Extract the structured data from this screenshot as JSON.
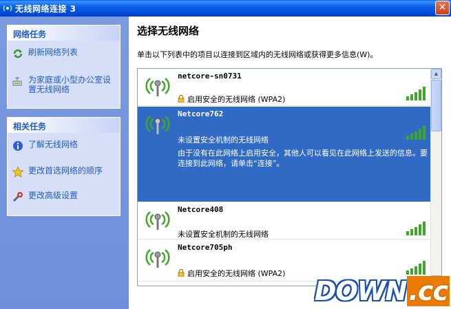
{
  "window": {
    "title": "无线网络连接 3",
    "close_label": "✕"
  },
  "sidebar": {
    "network_tasks": {
      "header": "网络任务",
      "items": [
        {
          "label": "刷新网络列表",
          "icon": "refresh-icon"
        },
        {
          "label": "为家庭或小型办公室设置无线网络",
          "icon": "network-setup-icon"
        }
      ]
    },
    "related_tasks": {
      "header": "相关任务",
      "items": [
        {
          "label": "了解无线网络",
          "icon": "info-icon"
        },
        {
          "label": "更改首选网络的顺序",
          "icon": "star-icon"
        },
        {
          "label": "更改高级设置",
          "icon": "settings-icon"
        }
      ]
    }
  },
  "main": {
    "title": "选择无线网络",
    "instruction": "单击以下列表中的项目以连接到区域内的无线网络或获得更多信息(W)。",
    "networks": [
      {
        "ssid": "netcore-sn0731",
        "security": "启用安全的无线网络 (WPA2)",
        "secured": true,
        "signal_bars": 5,
        "selected": false
      },
      {
        "ssid": "Netcore762",
        "security": "未设置安全机制的无线网络",
        "secured": false,
        "signal_bars": 5,
        "selected": true,
        "description": "由于没有在此网络上启用安全，其他人可以看见在此网络上发送的信息。要连接到此网络，请单击“连接”。"
      },
      {
        "ssid": "Netcore408",
        "security": "未设置安全机制的无线网络",
        "secured": false,
        "signal_bars": 5,
        "selected": false
      },
      {
        "ssid": "Netcore705ph",
        "security": "启用安全的无线网络 (WPA2)",
        "secured": true,
        "signal_bars": 5,
        "selected": false
      }
    ]
  },
  "watermark": {
    "part1": "DOWN",
    "part2": ".cc"
  },
  "colors": {
    "titlebar": "#0A5FE6",
    "sidebar": "#7A9AE0",
    "selection": "#316AC5",
    "signal": "#3FA628"
  }
}
